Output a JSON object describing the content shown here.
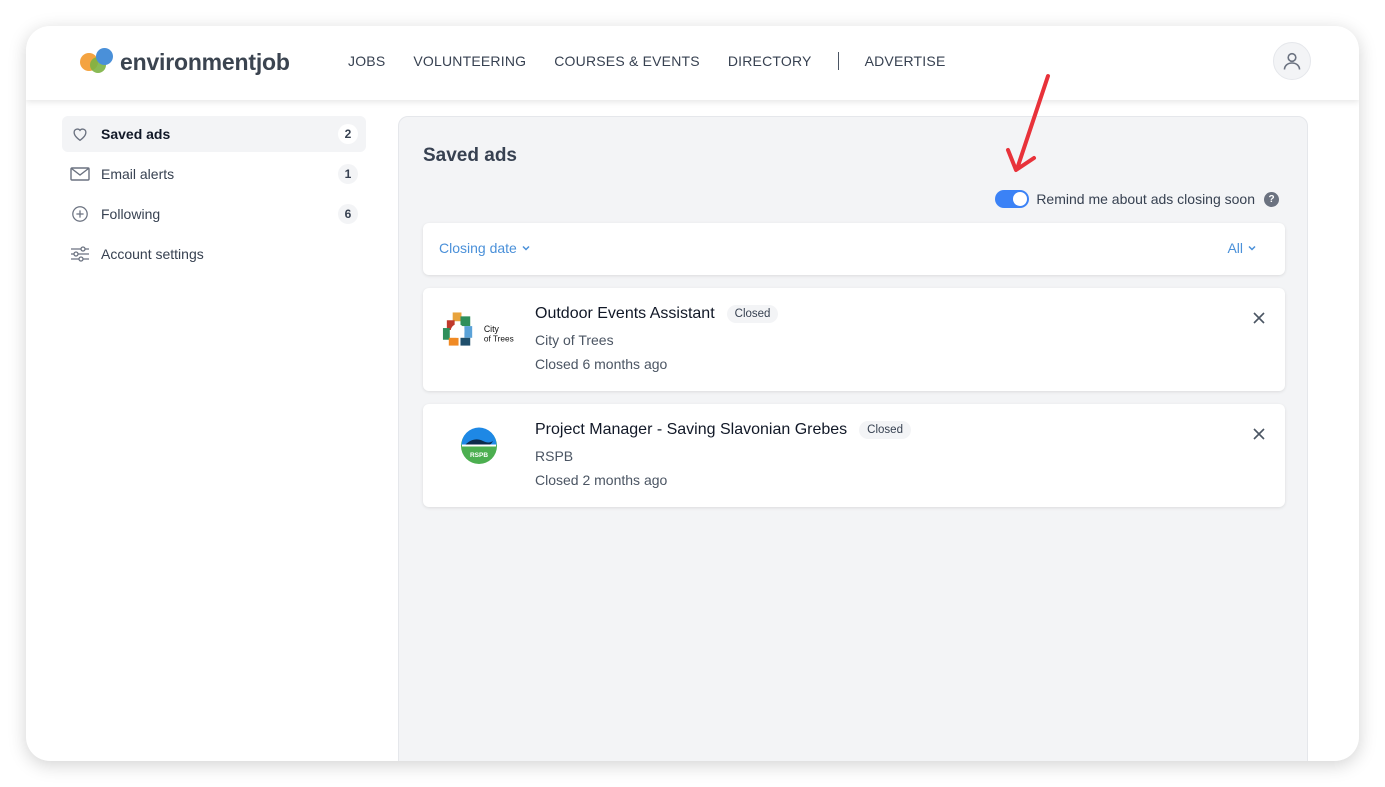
{
  "brand": {
    "name": "environmentjob"
  },
  "nav": {
    "items": [
      "JOBS",
      "VOLUNTEERING",
      "COURSES & EVENTS",
      "DIRECTORY"
    ],
    "advertise": "ADVERTISE"
  },
  "header": {
    "avatar_icon": "user-icon"
  },
  "sidebar": {
    "items": [
      {
        "label": "Saved ads",
        "count": "2",
        "icon": "heart-icon",
        "active": true
      },
      {
        "label": "Email alerts",
        "count": "1",
        "icon": "mail-icon"
      },
      {
        "label": "Following",
        "count": "6",
        "icon": "plus-circle-icon"
      },
      {
        "label": "Account settings",
        "icon": "sliders-icon"
      }
    ]
  },
  "main": {
    "title": "Saved ads",
    "reminder": {
      "label": "Remind me about ads closing soon",
      "enabled": true,
      "help": "?"
    },
    "filters": {
      "sort_label": "Closing date",
      "scope_label": "All"
    },
    "ads": [
      {
        "title": "Outdoor Events Assistant",
        "status": "Closed",
        "org": "City of Trees",
        "date": "Closed 6 months ago",
        "logo_text": [
          "City",
          "of Trees"
        ]
      },
      {
        "title": "Project Manager - Saving Slavonian Grebes",
        "status": "Closed",
        "org": "RSPB",
        "date": "Closed 2 months ago",
        "logo_text": [
          "RSPB"
        ]
      }
    ]
  },
  "colors": {
    "accent": "#3b82f6",
    "link": "#4a90d9",
    "annotation_arrow": "#e8323a"
  }
}
